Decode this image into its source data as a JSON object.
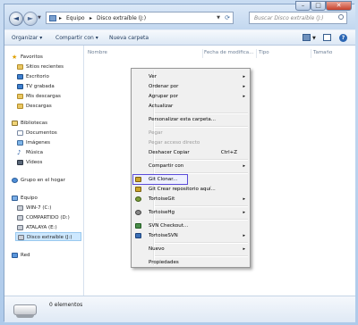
{
  "address": {
    "crumbs": [
      "Equipo",
      "Disco extraíble (J:)"
    ],
    "separator": "▸"
  },
  "search": {
    "placeholder": "Buscar Disco extraíble (J:)"
  },
  "window_controls": {
    "minimize": "–",
    "maximize": "□",
    "close": "✕"
  },
  "toolbar": {
    "organize": "Organizar ▾",
    "share": "Compartir con ▾",
    "new_folder": "Nueva carpeta"
  },
  "nav": {
    "favorites": "Favoritos",
    "recent": "Sitios recientes",
    "desktop": "Escritorio",
    "tv": "TV grabada",
    "my_downloads": "Mis descargas",
    "downloads": "Descargas",
    "libraries": "Bibliotecas",
    "documents": "Documentos",
    "images": "Imágenes",
    "music": "Música",
    "videos": "Vídeos",
    "homegroup": "Grupo en el hogar",
    "computer": "Equipo",
    "drive_c": "WIN-7 (C:)",
    "drive_d": "COMPARTIDO (D:)",
    "drive_e": "ATALAYA (E:)",
    "drive_j": "Disco extraíble (J:)",
    "network": "Red"
  },
  "columns": {
    "name": "Nombre",
    "date": "Fecha de modifica...",
    "type": "Tipo",
    "size": "Tamaño"
  },
  "details": {
    "count": "0 elementos"
  },
  "menu": {
    "view": "Ver",
    "sort_by": "Ordenar por",
    "group_by": "Agrupar por",
    "refresh": "Actualizar",
    "customize": "Personalizar esta carpeta...",
    "paste": "Pegar",
    "paste_shortcut": "Pegar acceso directo",
    "undo_copy": "Deshacer Copiar",
    "undo_shortcut": "Ctrl+Z",
    "share_with": "Compartir con",
    "git_clone": "Git Clonar...",
    "git_create": "Git Crear repositorio aquí...",
    "tortoisegit": "TortoiseGit",
    "tortoisehg": "TortoiseHg",
    "svn_checkout": "SVN Checkout...",
    "tortoisesvn": "TortoiseSVN",
    "new": "Nuevo",
    "properties": "Propiedades",
    "arrow": "▸"
  }
}
